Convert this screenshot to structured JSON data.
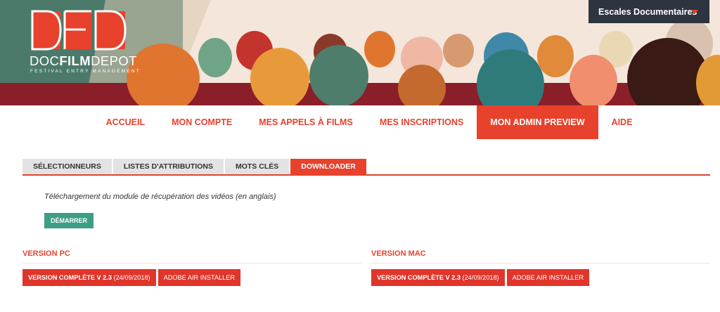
{
  "brand": {
    "name_light": "DOC",
    "name_bold": "FILM",
    "name_tail": "DEPOT",
    "tagline": "FESTIVAL ENTRY MANAGEMENT",
    "mark": "DFD"
  },
  "festival_selector": {
    "label": "Escales Documentaires",
    "icon": "caret-down-icon"
  },
  "main_nav": {
    "items": [
      "ACCUEIL",
      "MON COMPTE",
      "MES APPELS À FILMS",
      "MES INSCRIPTIONS",
      "MON ADMIN PREVIEW",
      "AIDE"
    ],
    "active": "MON ADMIN PREVIEW"
  },
  "sub_tabs": {
    "items": [
      "SÉLECTIONNEURS",
      "LISTES D'ATTRIBUTIONS",
      "MOTS CLÉS",
      "DOWNLOADER"
    ],
    "active": "DOWNLOADER"
  },
  "downloader": {
    "intro": "Téléchargement du module de récupération des vidéos (en anglais)",
    "start_label": "DÉMARRER"
  },
  "versions": {
    "pc": {
      "title": "VERSION PC",
      "full_label": "VERSION COMPLÈTE V 2.3",
      "full_date": "(24/09/2018)",
      "air_label": "ADOBE AIR INSTALLER"
    },
    "mac": {
      "title": "VERSION MAC",
      "full_label": "VERSION COMPLÈTE V 2.3",
      "full_date": "(24/09/2018)",
      "air_label": "ADOBE AIR INSTALLER"
    }
  },
  "colors": {
    "accent": "#e8412c",
    "dark": "#2e3440",
    "teal": "#3d9e86",
    "tab_inactive": "#e3e3e3"
  }
}
